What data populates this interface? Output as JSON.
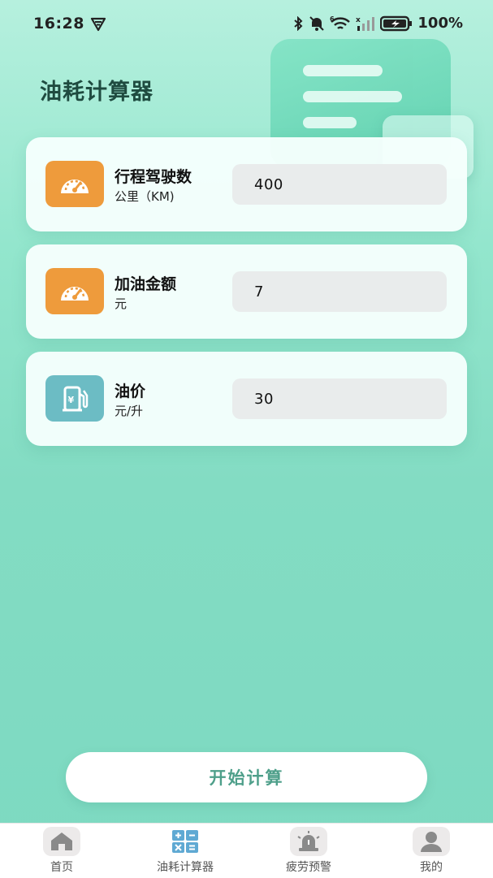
{
  "status_bar": {
    "time": "16:28",
    "battery": "100%",
    "icons": [
      "notification-icon",
      "bluetooth-icon",
      "mute-bell-icon",
      "wifi-icon",
      "signal-icon",
      "battery-charging-icon"
    ]
  },
  "header": {
    "title": "油耗计算器"
  },
  "inputs": [
    {
      "label": "行程驾驶数",
      "unit": "公里（KM)",
      "value": "400",
      "icon": "speedometer-icon",
      "color": "#ee9b3c"
    },
    {
      "label": "加油金额",
      "unit": "元",
      "value": "7",
      "icon": "speedometer-icon",
      "color": "#ee9b3c"
    },
    {
      "label": "油价",
      "unit": "元/升",
      "value": "30",
      "icon": "fuel-pump-icon",
      "color": "#6cbcc4"
    }
  ],
  "actions": {
    "start_label": "开始计算"
  },
  "tabs": [
    {
      "label": "首页",
      "icon": "home-icon"
    },
    {
      "label": "油耗计算器",
      "icon": "calculator-icon",
      "active": true
    },
    {
      "label": "疲劳预警",
      "icon": "alarm-light-icon"
    },
    {
      "label": "我的",
      "icon": "user-icon"
    }
  ],
  "colors": {
    "accent": "#4e9f8a",
    "title": "#1f4b40",
    "orange": "#ee9b3c",
    "teal": "#6cbcc4"
  }
}
